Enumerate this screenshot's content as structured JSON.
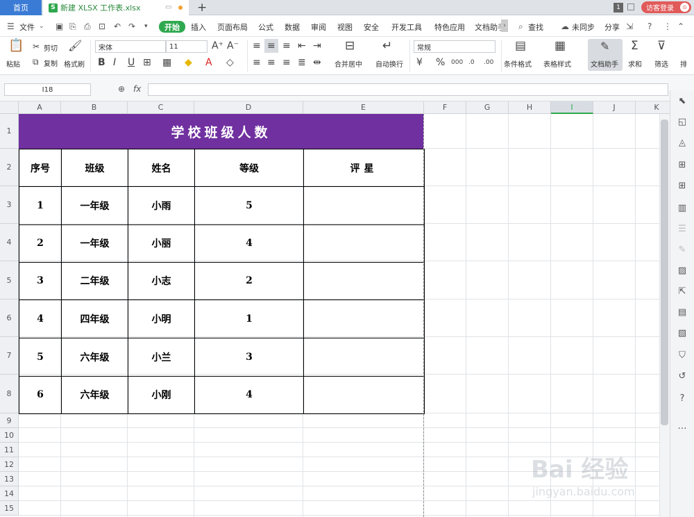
{
  "titlebar": {
    "home_tab": "首页",
    "doc_tab": "新建 XLSX 工作表.xlsx",
    "doc_icon": "S",
    "badge": "1",
    "login": "访客登录",
    "avatar": "⊙"
  },
  "menu": {
    "file": "文件",
    "start": "开始",
    "items": [
      "插入",
      "页面布局",
      "公式",
      "数据",
      "审阅",
      "视图",
      "安全",
      "开发工具",
      "特色应用",
      "文档助手"
    ],
    "search": "查找",
    "unsync": "未同步",
    "share": "分享"
  },
  "ribbon": {
    "paste": "粘贴",
    "cut": "剪切",
    "copy": "复制",
    "format_painter": "格式刷",
    "font": "宋体",
    "size": "11",
    "merge": "合并居中",
    "wrap": "自动换行",
    "number_format": "常规",
    "cond_format": "条件格式",
    "table_style": "表格样式",
    "doc_assistant": "文档助手",
    "sum": "求和",
    "filter": "筛选",
    "sort": "排"
  },
  "formula": {
    "namebox": "I18",
    "fx": "fx",
    "value": ""
  },
  "columns": [
    "A",
    "B",
    "C",
    "D",
    "E",
    "F",
    "G",
    "H",
    "I",
    "J",
    "K"
  ],
  "selected_column": "I",
  "rows": [
    "1",
    "2",
    "3",
    "4",
    "5",
    "6",
    "7",
    "8",
    "9",
    "10",
    "11",
    "12",
    "13",
    "14",
    "15"
  ],
  "sheet_title": "学校班级人数",
  "headers": [
    "序号",
    "班级",
    "姓名",
    "等级",
    "评星"
  ],
  "table_rows": [
    [
      "1",
      "一年级",
      "小雨",
      "5",
      ""
    ],
    [
      "2",
      "一年级",
      "小丽",
      "4",
      ""
    ],
    [
      "3",
      "二年级",
      "小志",
      "2",
      ""
    ],
    [
      "4",
      "四年级",
      "小明",
      "1",
      ""
    ],
    [
      "5",
      "六年级",
      "小兰",
      "3",
      ""
    ],
    [
      "6",
      "六年级",
      "小刚",
      "4",
      ""
    ]
  ],
  "watermark": {
    "text": "Bai 经验",
    "url": "jingyan.baidu.com"
  },
  "colors": {
    "accent": "#2fa84f",
    "title_bg": "#7030a0",
    "home_tab": "#3a7bd5",
    "login": "#e15a5a"
  }
}
